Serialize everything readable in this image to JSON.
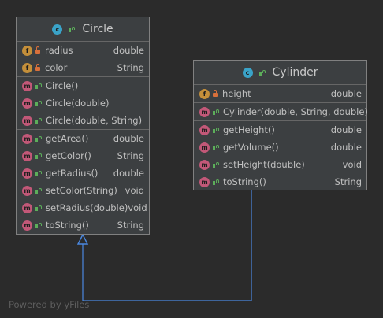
{
  "classes": {
    "circle": {
      "name": "Circle",
      "fields": [
        {
          "name": "radius",
          "type": "double"
        },
        {
          "name": "color",
          "type": "String"
        }
      ],
      "constructors": [
        {
          "name": "Circle()",
          "type": ""
        },
        {
          "name": "Circle(double)",
          "type": ""
        },
        {
          "name": "Circle(double, String)",
          "type": ""
        }
      ],
      "methods": [
        {
          "name": "getArea()",
          "type": "double"
        },
        {
          "name": "getColor()",
          "type": "String"
        },
        {
          "name": "getRadius()",
          "type": "double"
        },
        {
          "name": "setColor(String)",
          "type": "void"
        },
        {
          "name": "setRadius(double)",
          "type": "void"
        },
        {
          "name": "toString()",
          "type": "String"
        }
      ]
    },
    "cylinder": {
      "name": "Cylinder",
      "fields": [
        {
          "name": "height",
          "type": "double"
        }
      ],
      "constructors": [
        {
          "name": "Cylinder(double, String, double)",
          "type": ""
        }
      ],
      "methods": [
        {
          "name": "getHeight()",
          "type": "double"
        },
        {
          "name": "getVolume()",
          "type": "double"
        },
        {
          "name": "setHeight(double)",
          "type": "void"
        },
        {
          "name": "toString()",
          "type": "String"
        }
      ]
    }
  },
  "badges": {
    "class": "c",
    "field": "f",
    "method": "m"
  },
  "colors": {
    "background": "#2b2b2b",
    "edge": "#4a88e0",
    "field_badge": "#c48f3a",
    "method_badge": "#c25878",
    "class_badge": "#3aa3c8"
  },
  "relationship": "Cylinder extends Circle",
  "watermark": "Powered by yFiles"
}
